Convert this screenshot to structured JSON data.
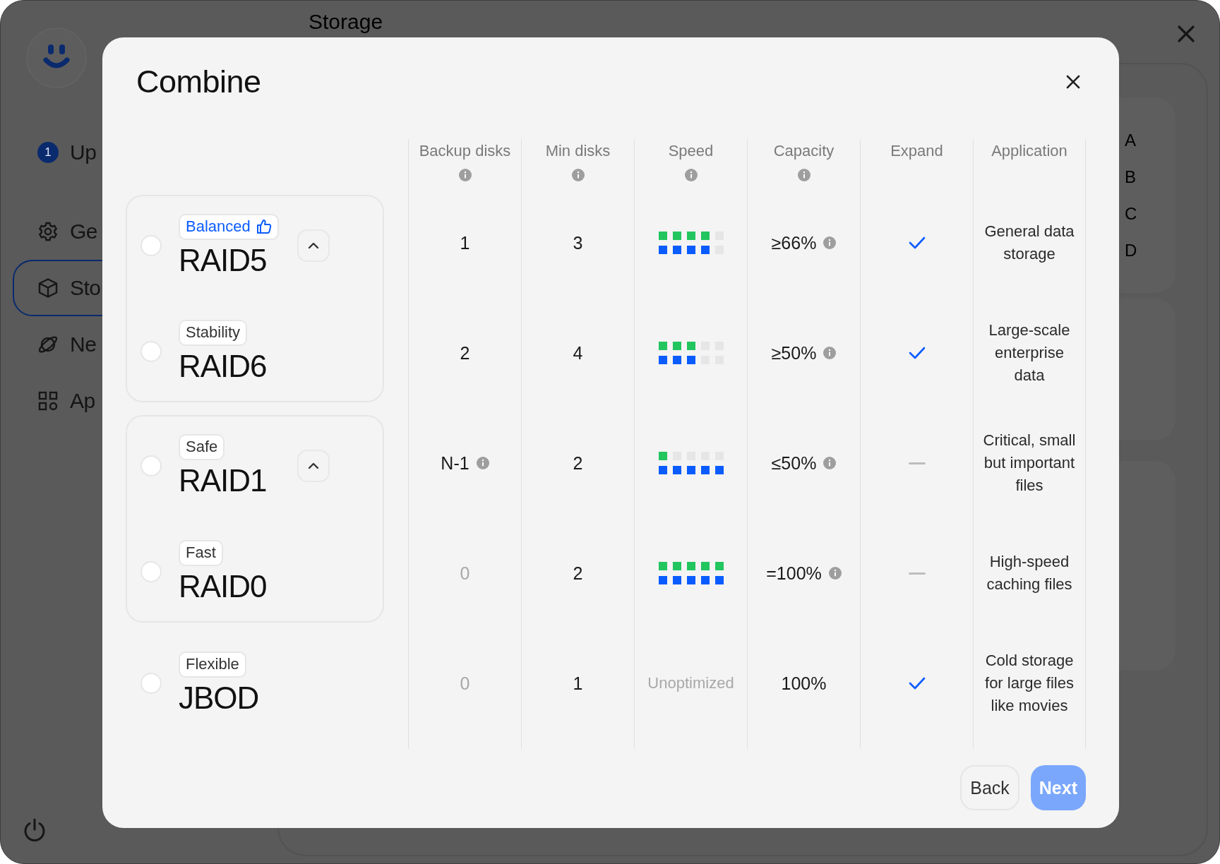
{
  "app": {
    "page_title": "Storage",
    "sidebar": [
      {
        "label": "Up",
        "badge": "1",
        "selected": false
      },
      {
        "label": "Ge",
        "selected": false
      },
      {
        "label": "Sto",
        "selected": true
      },
      {
        "label": "Ne",
        "selected": false
      },
      {
        "label": "Ap",
        "selected": false
      }
    ],
    "panel_labels": [
      "A",
      "B",
      "C",
      "D"
    ]
  },
  "dialog": {
    "title": "Combine",
    "columns": [
      {
        "label": "Backup disks",
        "info": true
      },
      {
        "label": "Min disks",
        "info": true
      },
      {
        "label": "Speed",
        "info": true
      },
      {
        "label": "Capacity",
        "info": true
      },
      {
        "label": "Expand",
        "info": false
      },
      {
        "label": "Application",
        "info": false
      }
    ],
    "groups": [
      {
        "kind": "card",
        "expanded": true,
        "options": [
          {
            "tag": "Balanced",
            "recommended": true,
            "name": "RAID5",
            "selected": false,
            "backup": {
              "text": "1",
              "muted": false,
              "info": false
            },
            "min_disks": "3",
            "speed": {
              "kind": "meter",
              "bars": [
                {
                  "color": "#22c55e",
                  "level": 0.8
                },
                {
                  "color": "#0a5cff",
                  "level": 0.8
                }
              ]
            },
            "capacity": {
              "text": "≥66%",
              "info": true
            },
            "expand": true,
            "application": "General data storage"
          },
          {
            "tag": "Stability",
            "recommended": false,
            "name": "RAID6",
            "selected": false,
            "backup": {
              "text": "2",
              "muted": false,
              "info": false
            },
            "min_disks": "4",
            "speed": {
              "kind": "meter",
              "bars": [
                {
                  "color": "#22c55e",
                  "level": 0.6
                },
                {
                  "color": "#0a5cff",
                  "level": 0.6
                }
              ]
            },
            "capacity": {
              "text": "≥50%",
              "info": true
            },
            "expand": true,
            "application": "Large-scale enterprise data"
          }
        ]
      },
      {
        "kind": "card",
        "expanded": true,
        "options": [
          {
            "tag": "Safe",
            "recommended": false,
            "name": "RAID1",
            "selected": false,
            "backup": {
              "text": "N-1",
              "muted": false,
              "info": true
            },
            "min_disks": "2",
            "speed": {
              "kind": "meter",
              "bars": [
                {
                  "color": "#22c55e",
                  "level": 0.2
                },
                {
                  "color": "#0a5cff",
                  "level": 1
                }
              ]
            },
            "capacity": {
              "text": "≤50%",
              "info": true
            },
            "expand": false,
            "application": "Critical, small but important files"
          },
          {
            "tag": "Fast",
            "recommended": false,
            "name": "RAID0",
            "selected": false,
            "backup": {
              "text": "0",
              "muted": true,
              "info": false
            },
            "min_disks": "2",
            "speed": {
              "kind": "meter",
              "bars": [
                {
                  "color": "#22c55e",
                  "level": 1
                },
                {
                  "color": "#0a5cff",
                  "level": 1
                }
              ]
            },
            "capacity": {
              "text": "=100%",
              "info": true
            },
            "expand": false,
            "application": "High-speed caching files"
          }
        ]
      },
      {
        "kind": "plain",
        "options": [
          {
            "tag": "Flexible",
            "recommended": false,
            "name": "JBOD",
            "selected": false,
            "backup": {
              "text": "0",
              "muted": true,
              "info": false
            },
            "min_disks": "1",
            "speed": {
              "kind": "text",
              "text": "Unoptimized"
            },
            "capacity": {
              "text": "100%",
              "info": false
            },
            "expand": true,
            "application": "Cold storage for large files like movies"
          }
        ]
      }
    ],
    "buttons": [
      {
        "label": "Back",
        "kind": "secondary",
        "disabled": false
      },
      {
        "label": "Next",
        "kind": "primary",
        "disabled": true
      }
    ]
  }
}
